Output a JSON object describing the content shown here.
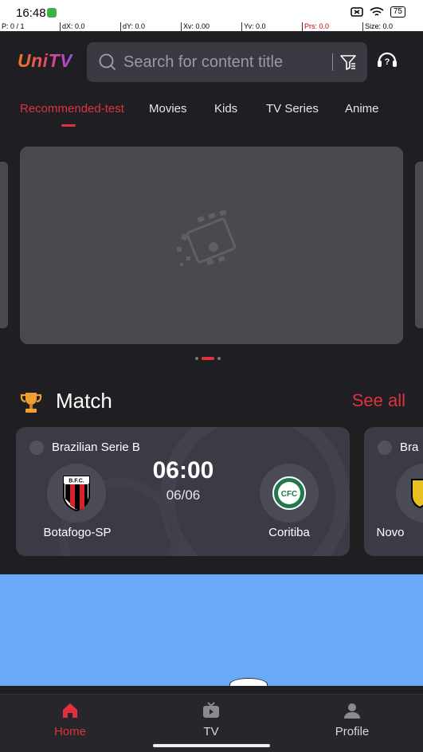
{
  "status_bar": {
    "time": "16:48",
    "battery": "75"
  },
  "debug_bar": {
    "p": "P: 0 / 1",
    "dx": "dX: 0.0",
    "dy": "dY: 0.0",
    "xv": "Xv: 0.00",
    "yv": "Yv: 0.0",
    "prs": "Prs: 0.0",
    "size": "Size: 0.0"
  },
  "header": {
    "logo": "UniTV",
    "search_placeholder": "Search for content title"
  },
  "tabs": [
    {
      "label": "Recommended-test",
      "active": true
    },
    {
      "label": "Movies"
    },
    {
      "label": "Kids"
    },
    {
      "label": "TV Series"
    },
    {
      "label": "Anime"
    }
  ],
  "section": {
    "title": "Match",
    "see_all": "See all"
  },
  "match": {
    "league": "Brazilian Serie B",
    "time": "06:00",
    "date": "06/06",
    "home_team": "Botafogo-SP",
    "home_abbr": "B.F.C.",
    "away_team": "Coritiba",
    "away_abbr": "CFC"
  },
  "match2": {
    "league": "Bra",
    "home_team": "Novo"
  },
  "bottom_nav": [
    {
      "label": "Home",
      "active": true,
      "icon": "home-icon"
    },
    {
      "label": "TV",
      "icon": "tv-icon"
    },
    {
      "label": "Profile",
      "icon": "profile-icon"
    }
  ],
  "colors": {
    "accent": "#e0323c",
    "background": "#1f1f23",
    "card": "#3b3b45"
  }
}
